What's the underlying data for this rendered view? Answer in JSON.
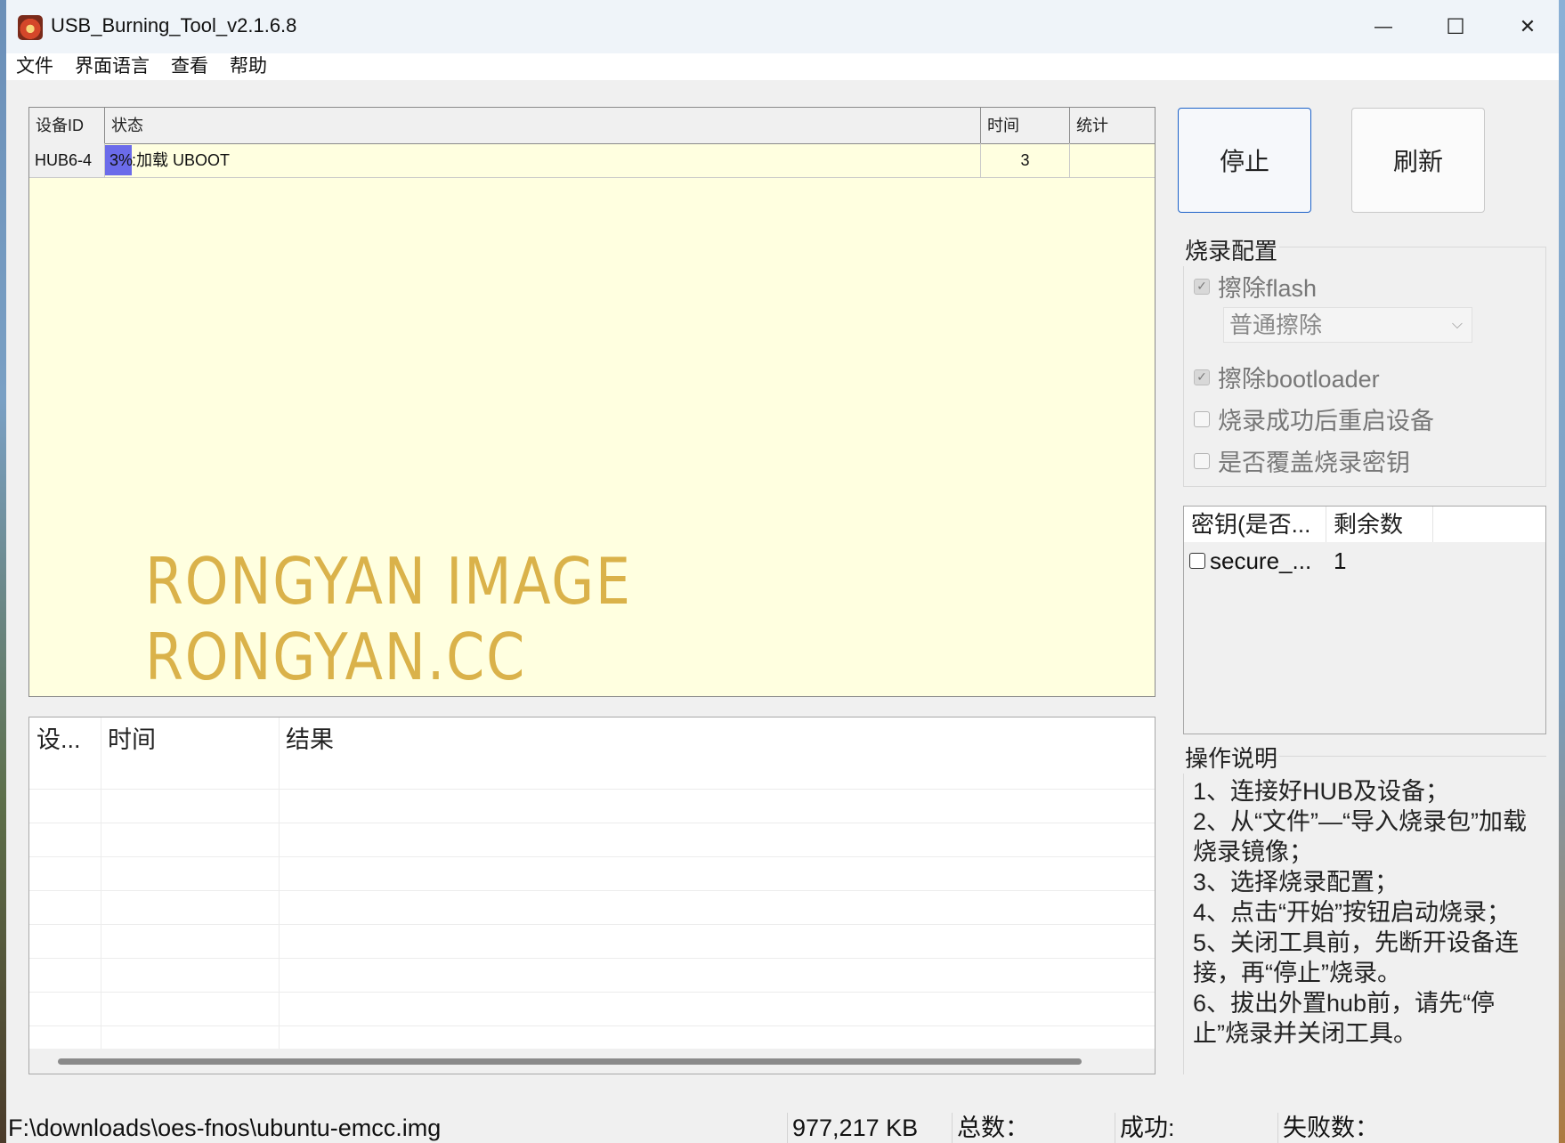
{
  "window": {
    "title": "USB_Burning_Tool_v2.1.6.8",
    "minimize_glyph": "—",
    "maximize_glyph": "☐",
    "close_glyph": "✕"
  },
  "menu": [
    "文件",
    "界面语言",
    "查看",
    "帮助"
  ],
  "device_table": {
    "headers": [
      "设备ID",
      "状态",
      "时间",
      "统计"
    ],
    "rows": [
      {
        "id": "HUB6-4",
        "progress_percent": 3,
        "progress_label": "3%",
        "status": ":加载 UBOOT",
        "time": "3",
        "stats": ""
      }
    ],
    "row_color": "#ffffe0",
    "progress_color": "#6b6bea"
  },
  "watermark": {
    "line1": "RONGYAN IMAGE",
    "line2": "RONGYAN.CC"
  },
  "buttons": {
    "stop": "停止",
    "refresh": "刷新"
  },
  "burn_config": {
    "title": "烧录配置",
    "erase_flash": {
      "label": "擦除flash",
      "checked": true
    },
    "erase_mode": "普通擦除",
    "erase_bootloader": {
      "label": "擦除bootloader",
      "checked": true
    },
    "reboot_after": {
      "label": "烧录成功后重启设备",
      "checked": false
    },
    "overwrite_key": {
      "label": "是否覆盖烧录密钥",
      "checked": false
    }
  },
  "key_list": {
    "headers": [
      "密钥(是否...",
      "剩余数"
    ],
    "rows": [
      {
        "name": "secure_...",
        "remaining": "1",
        "checked": false
      }
    ]
  },
  "log_list": {
    "headers": [
      "设...",
      "时间",
      "结果"
    ]
  },
  "instructions": {
    "title": "操作说明",
    "lines": [
      "1、连接好HUB及设备；",
      "2、从“文件”—“导入烧录包”加载烧录镜像；",
      "3、选择烧录配置；",
      "4、点击“开始”按钮启动烧录；",
      "5、关闭工具前，先断开设备连接，再“停止”烧录。",
      "6、拔出外置hub前，请先“停止”烧录并关闭工具。"
    ]
  },
  "status_bar": {
    "path": "F:\\downloads\\oes-fnos\\ubuntu-emcc.img",
    "size": "977,217 KB",
    "total": "总数：",
    "success": "成功:",
    "failed": "失败数："
  }
}
